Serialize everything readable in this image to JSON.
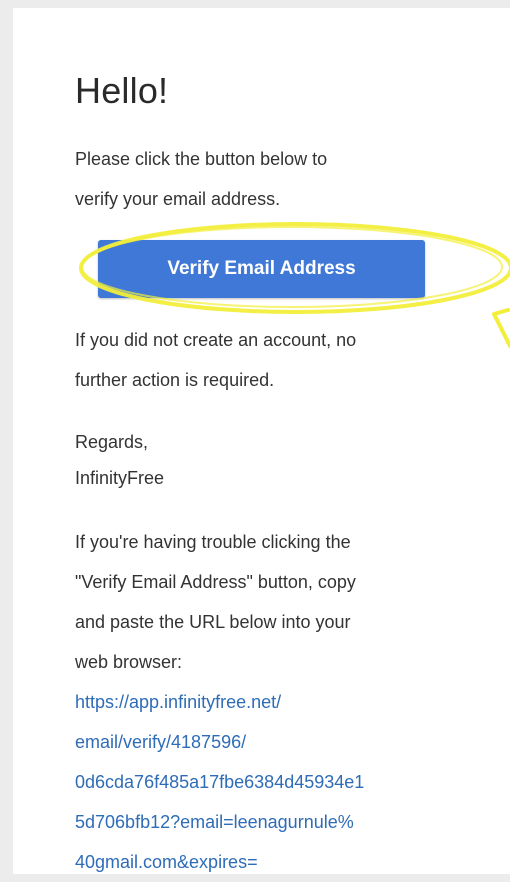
{
  "email": {
    "greeting": "Hello!",
    "intro_line1": "Please click the button below to",
    "intro_line2": "verify your email address.",
    "button_label": "Verify Email Address",
    "no_account_line1": "If you did not create an account, no",
    "no_account_line2": "further action is required.",
    "regards": "Regards,",
    "signature": "InfinityFree",
    "trouble_line1": "If you're having trouble clicking the",
    "trouble_line2": "\"Verify Email Address\" button, copy",
    "trouble_line3": "and paste the URL below into your",
    "trouble_line4": "web browser:",
    "url_line1": "https://app.infinityfree.net/",
    "url_line2": "email/verify/4187596/",
    "url_line3": "0d6cda76f485a17fbe6384d45934e1",
    "url_line4": "5d706bfb12?email=leenagurnule%",
    "url_line5": "40gmail.com&expires="
  },
  "colors": {
    "button": "#3f78d6",
    "link": "#2e6cb8",
    "highlight": "#f2ee3a"
  }
}
